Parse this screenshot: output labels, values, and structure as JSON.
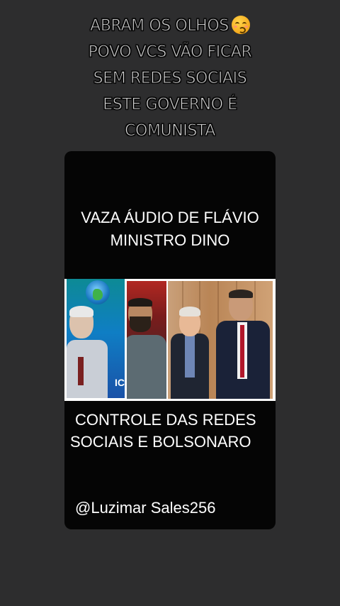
{
  "caption": {
    "lines": [
      "ABRAM OS OLHOS",
      "POVO VCS VÃO FICAR",
      "SEM REDES SOCIAIS",
      "ESTE GOVERNO É",
      "COMUNISTA"
    ],
    "emoji": "kissing-face-with-smiling-eyes"
  },
  "video": {
    "headline": [
      "VAZA  ÁUDIO DE FLÁVIO",
      "MINISTRO DINO"
    ],
    "image_strip_text": "ICI",
    "subline": [
      "CONTROLE DAS REDES",
      "SOCIAIS E BOLSONARO"
    ],
    "handle": "@Luzimar Sales256"
  },
  "colors": {
    "background": "#2d2d2e",
    "card": "#050505",
    "text": "#ffffff"
  }
}
